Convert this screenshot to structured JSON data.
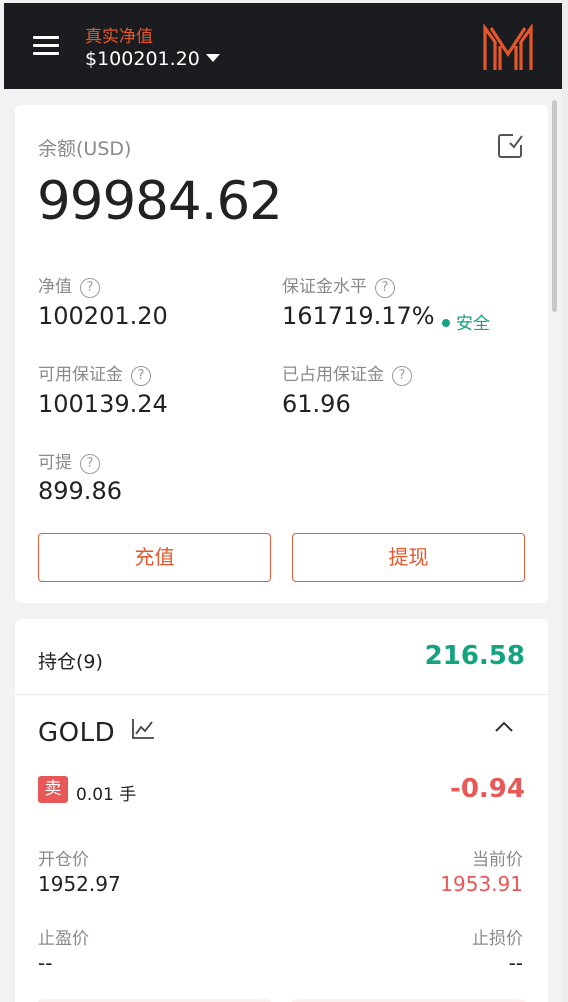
{
  "header": {
    "equity_label": "真实净值",
    "equity_value": "$100201.20",
    "menu_icon": "hamburger-menu-icon",
    "logo_icon": "m-logo-icon"
  },
  "account": {
    "balance_label": "余额(USD)",
    "balance_value": "99984.62",
    "edit_icon": "edit-checkbox-icon",
    "equity_label": "净值",
    "equity_value": "100201.20",
    "margin_level_label": "保证金水平",
    "margin_level_value": "161719.17%",
    "margin_status": "安全",
    "free_margin_label": "可用保证金",
    "free_margin_value": "100139.24",
    "used_margin_label": "已占用保证金",
    "used_margin_value": "61.96",
    "withdrawable_label": "可提",
    "withdrawable_value": "899.86",
    "help_glyph": "?",
    "deposit_label": "充值",
    "withdraw_label": "提现"
  },
  "positions": {
    "title": "持仓(9)",
    "total_pnl": "216.58",
    "item": {
      "symbol": "GOLD",
      "side": "卖",
      "lots": "0.01 手",
      "pnl": "-0.94",
      "open_price_label": "开仓价",
      "open_price": "1952.97",
      "current_price_label": "当前价",
      "current_price": "1953.91",
      "take_profit_label": "止盈价",
      "take_profit": "--",
      "stop_loss_label": "止损价",
      "stop_loss": "--"
    }
  },
  "colors": {
    "accent": "#e5572b",
    "profit": "#14a37f",
    "loss": "#e85858",
    "header_bg": "#1b1c20"
  }
}
